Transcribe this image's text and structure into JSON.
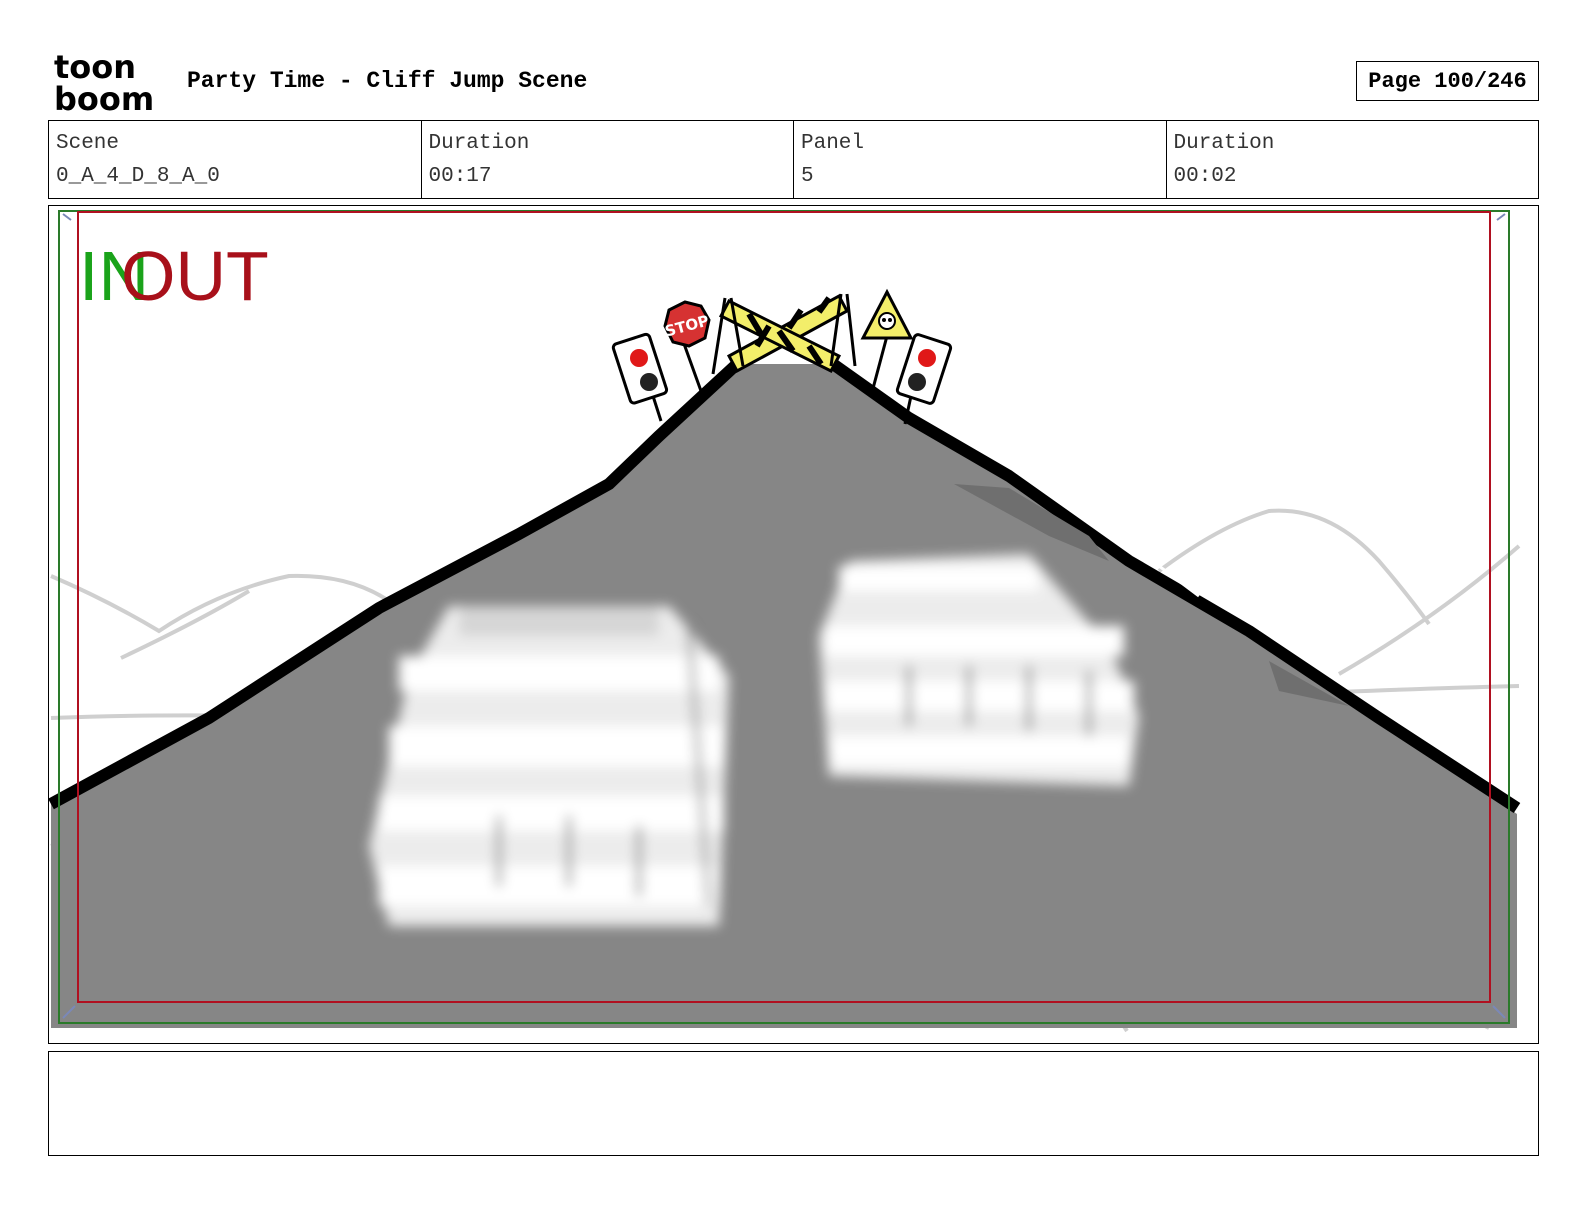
{
  "logo": {
    "top_text": "toon",
    "bottom_text": "boom"
  },
  "header": {
    "title": "Party Time - Cliff Jump Scene",
    "page": "Page 100/246"
  },
  "info": [
    {
      "label": "Scene",
      "value": "0_A_4_D_8_A_0"
    },
    {
      "label": "Duration",
      "value": "00:17"
    },
    {
      "label": "Panel",
      "value": "5"
    },
    {
      "label": "Duration",
      "value": "00:02"
    }
  ],
  "panel": {
    "in_label": "IN",
    "out_label": "OUT",
    "stop_sign": "STOP",
    "colors": {
      "road": "#868686",
      "in_marker": "#1aa31a",
      "out_marker": "#a8101a",
      "safe_frame_red": "#b01020",
      "safe_frame_green": "#2a7a2a",
      "caution_yellow": "#f3ee6a",
      "stop_red": "#d63232"
    }
  },
  "notes": {
    "text": ""
  }
}
